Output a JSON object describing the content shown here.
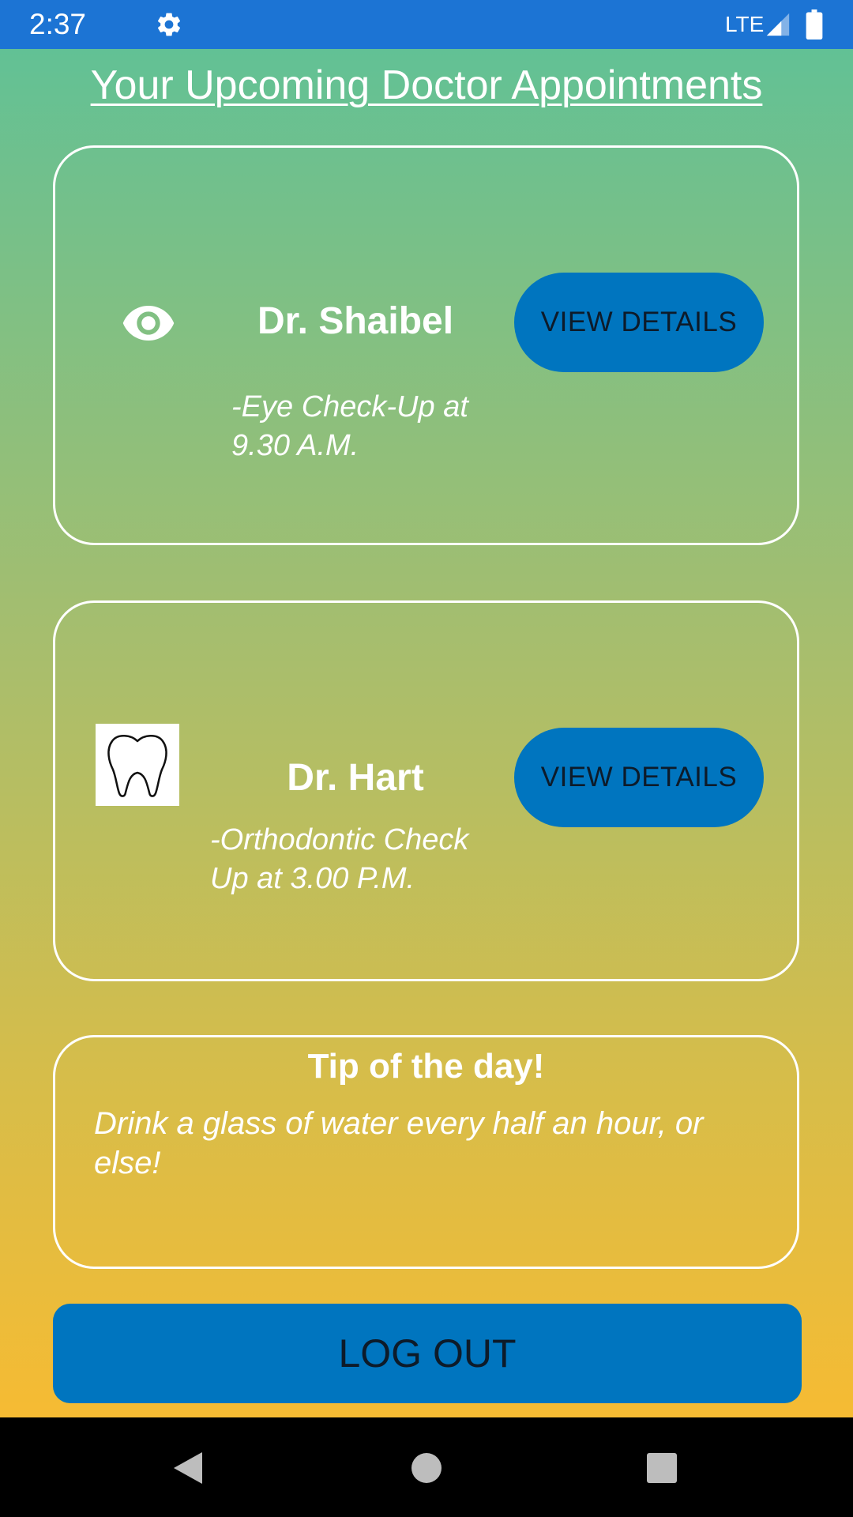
{
  "status_bar": {
    "time": "2:37",
    "network": "LTE",
    "background_color": "#1c74d4",
    "icons": [
      "gear-icon",
      "signal-icon",
      "battery-icon"
    ]
  },
  "header": {
    "title": "Your Upcoming Doctor Appointments"
  },
  "appointments": [
    {
      "icon": "eye-icon",
      "doctor": "Dr. Shaibel",
      "description": "-Eye Check-Up at 9.30 A.M.",
      "button_label": "VIEW DETAILS"
    },
    {
      "icon": "tooth-icon",
      "doctor": "Dr. Hart",
      "description": "-Orthodontic Check Up at 3.00 P.M.",
      "button_label": "VIEW DETAILS"
    }
  ],
  "tip": {
    "title": "Tip of the day!",
    "text": "Drink a glass of water every half an hour, or else!"
  },
  "logout": {
    "label": "LOG OUT"
  },
  "colors": {
    "button": "#0075bf",
    "gradient_top": "#62c195",
    "gradient_bottom": "#f6bb33",
    "card_border": "#ffffff"
  },
  "nav_bar": {
    "icons": [
      "back-icon",
      "home-icon",
      "recents-icon"
    ]
  }
}
